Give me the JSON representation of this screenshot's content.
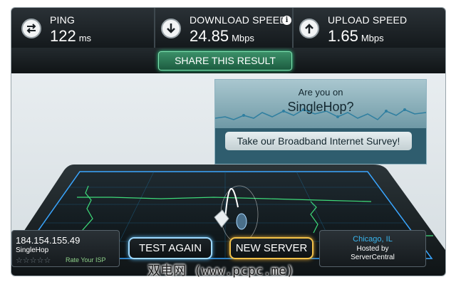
{
  "stats": {
    "ping": {
      "label": "PING",
      "value": "122",
      "unit": "ms",
      "icon": "swap-arrows-icon"
    },
    "download": {
      "label": "DOWNLOAD SPEED",
      "value": "24.85",
      "unit": "Mbps",
      "icon": "arrow-down-icon"
    },
    "upload": {
      "label": "UPLOAD SPEED",
      "value": "1.65",
      "unit": "Mbps",
      "icon": "arrow-up-icon"
    },
    "info_symbol": "i"
  },
  "share": {
    "label": "SHARE THIS RESULT"
  },
  "ad": {
    "question_line1": "Are you on",
    "question_line2": "SingleHop?",
    "cta": "Take our Broadband Internet Survey!"
  },
  "client": {
    "ip": "184.154.155.49",
    "isp": "SingleHop",
    "stars": "☆☆☆☆☆",
    "rate_label": "Rate Your ISP"
  },
  "buttons": {
    "test_again": "TEST AGAIN",
    "new_server": "NEW SERVER"
  },
  "server": {
    "city": "Chicago, IL",
    "hosted_by": "Hosted by",
    "host": "ServerCentral"
  },
  "watermark": "双电网 (www.pcpc.me)",
  "colors": {
    "accent_green": "#3be495",
    "accent_blue": "#39b7f0",
    "accent_gold": "#f3c24a",
    "bar_dark": "#1a2024"
  }
}
